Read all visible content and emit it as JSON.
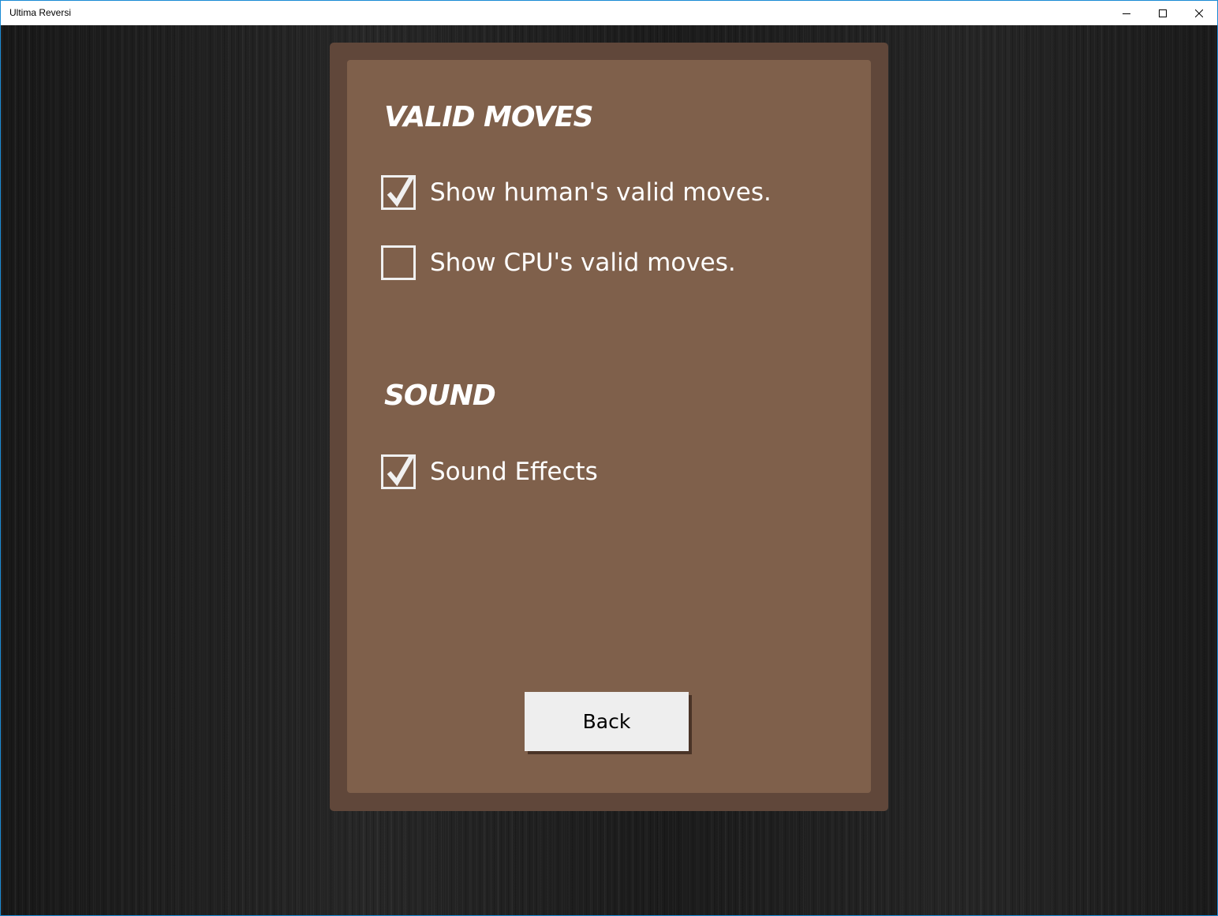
{
  "window": {
    "title": "Ultima Reversi",
    "controls": {
      "minimize_icon": "minimize-icon",
      "maximize_icon": "maximize-icon",
      "close_icon": "close-icon"
    }
  },
  "settings": {
    "valid_moves": {
      "heading": "VALID MOVES",
      "options": [
        {
          "label": "Show human's valid moves.",
          "checked": true
        },
        {
          "label": "Show CPU's valid moves.",
          "checked": false
        }
      ]
    },
    "sound": {
      "heading": "SOUND",
      "options": [
        {
          "label": "Sound Effects",
          "checked": true
        }
      ]
    },
    "back_label": "Back"
  },
  "colors": {
    "panel_outer": "#60473a",
    "panel_inner": "#7f604b",
    "button_bg": "#eeeeee",
    "text": "#ffffff",
    "window_border": "#1a8ad4"
  }
}
